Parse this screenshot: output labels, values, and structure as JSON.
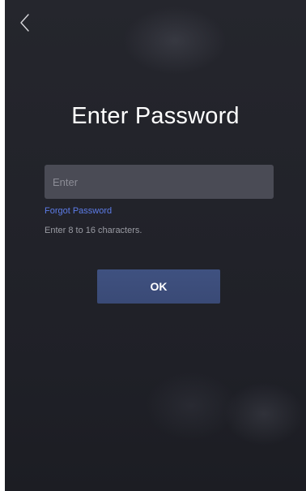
{
  "header": {
    "back_icon": "chevron-left-icon"
  },
  "page": {
    "title": "Enter Password"
  },
  "password_field": {
    "value": "",
    "placeholder": "Enter"
  },
  "forgot_password_label": "Forgot Password",
  "hint": "Enter 8 to 16 characters.",
  "ok_label": "OK",
  "colors": {
    "background": "#23242b",
    "input_background": "#4a4b55",
    "link": "#5d7ce8",
    "primary_button": "#3d4e7b",
    "title_text": "#ffffff",
    "hint_text": "#9a9ba3"
  }
}
